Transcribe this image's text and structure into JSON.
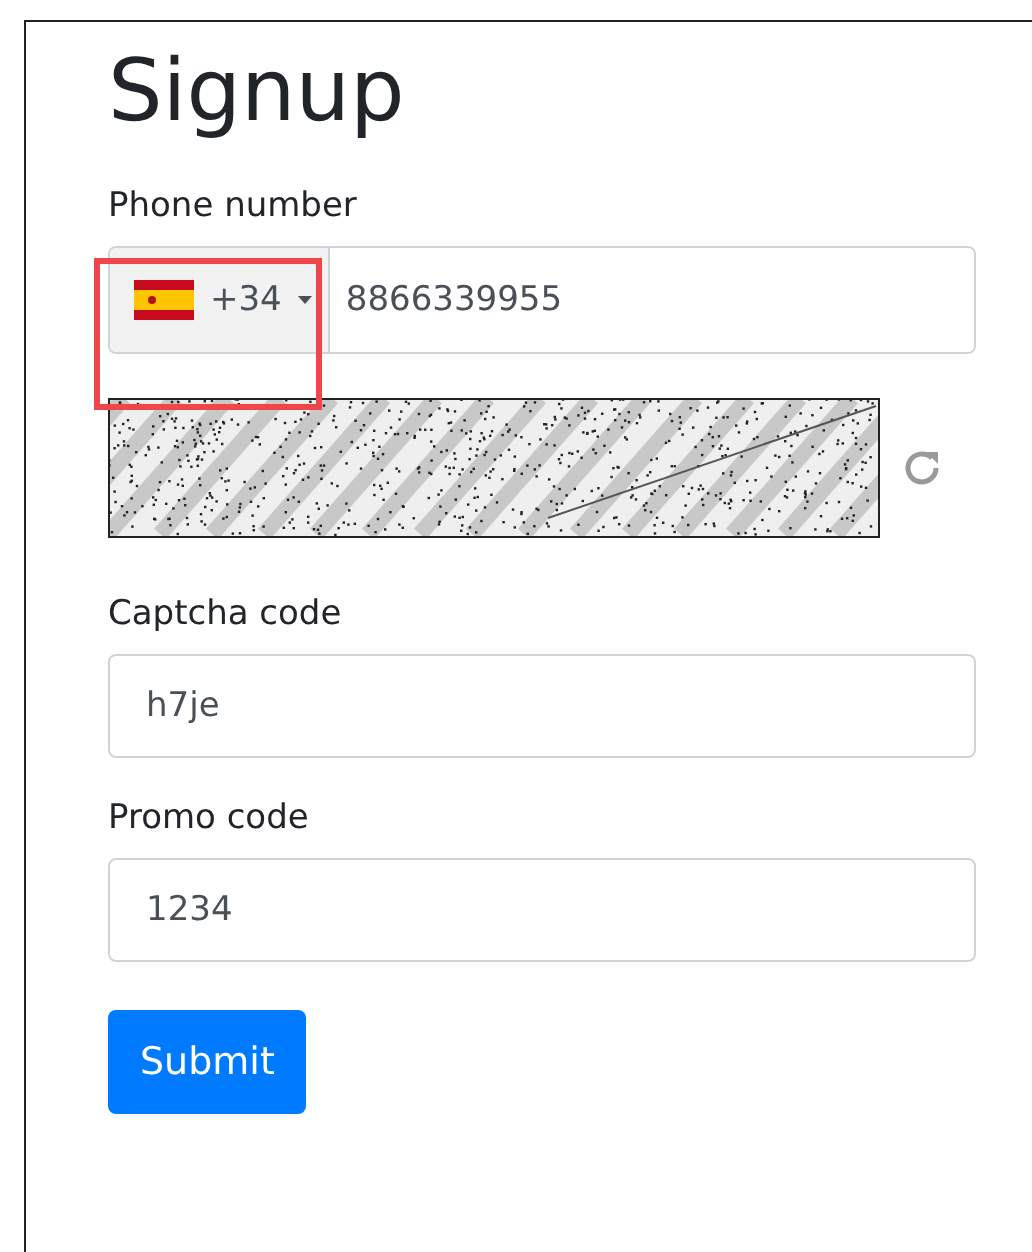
{
  "title": "Signup",
  "phone": {
    "label": "Phone number",
    "country_code": "+34",
    "value": "8866339955"
  },
  "captcha_code": {
    "label": "Captcha code",
    "value": "h7je"
  },
  "promo_code": {
    "label": "Promo code",
    "value": "1234"
  },
  "submit": "Submit"
}
